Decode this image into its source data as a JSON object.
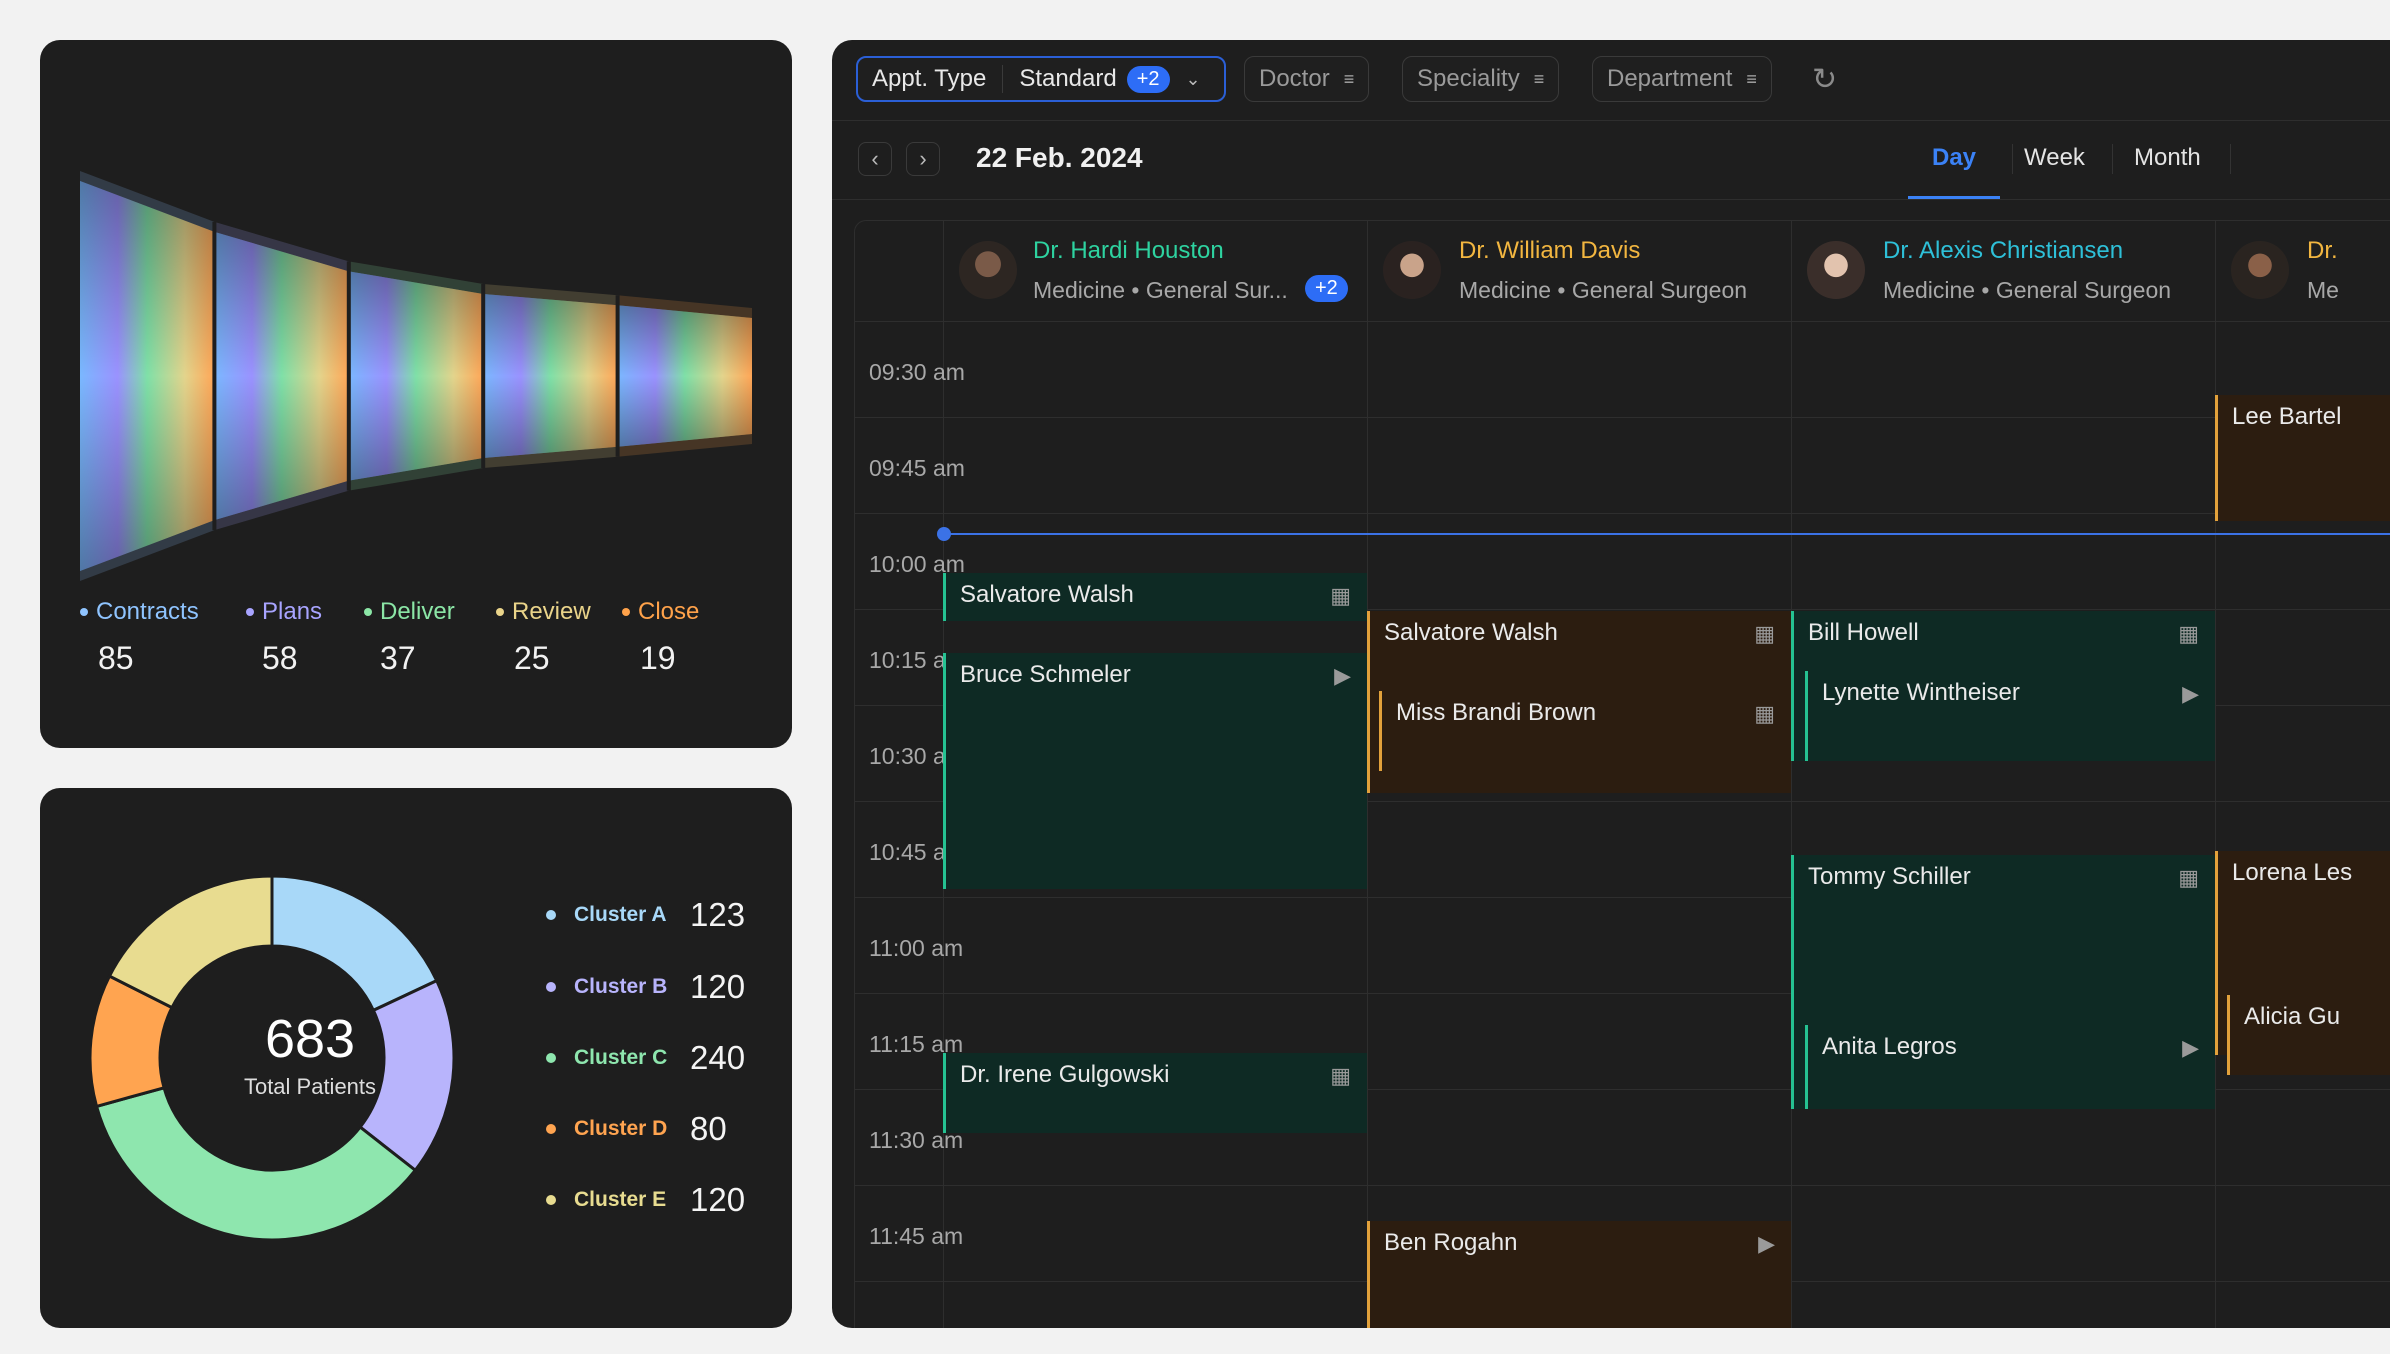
{
  "funnel": {
    "stages": [
      {
        "name": "Contracts",
        "value": "85",
        "color": "#8fc4ff"
      },
      {
        "name": "Plans",
        "value": "58",
        "color": "#a8a4ff"
      },
      {
        "name": "Deliver",
        "value": "37",
        "color": "#8be6a6"
      },
      {
        "name": "Review",
        "value": "25",
        "color": "#ead48a"
      },
      {
        "name": "Close",
        "value": "19",
        "color": "#ffa24a"
      }
    ]
  },
  "donut": {
    "total": "683",
    "caption": "Total Patients",
    "clusters": [
      {
        "name": "Cluster A",
        "value": "123",
        "color": "#a8d8f8"
      },
      {
        "name": "Cluster B",
        "value": "120",
        "color": "#b8b4fc"
      },
      {
        "name": "Cluster C",
        "value": "240",
        "color": "#8ee6ae"
      },
      {
        "name": "Cluster D",
        "value": "80",
        "color": "#ffa450"
      },
      {
        "name": "Cluster E",
        "value": "120",
        "color": "#e8dc90"
      }
    ]
  },
  "scheduler": {
    "filters": {
      "appt_type_label": "Appt. Type",
      "appt_type_value": "Standard",
      "appt_type_badge": "+2",
      "doctor": "Doctor",
      "speciality": "Speciality",
      "department": "Department"
    },
    "date": "22 Feb. 2024",
    "views": {
      "day": "Day",
      "week": "Week",
      "month": "Month"
    },
    "times": [
      "09:30 am",
      "09:45 am",
      "10:00 am",
      "10:15 am",
      "10:30 am",
      "10:45 am",
      "11:00 am",
      "11:15 am",
      "11:30 am",
      "11:45 am"
    ],
    "doctors": [
      {
        "name": "Dr. Hardi Houston",
        "sub": "Medicine • General Sur...",
        "badge": "+2",
        "color": "#2ed3a0"
      },
      {
        "name": "Dr. William Davis",
        "sub": "Medicine • General Surgeon",
        "color": "#f2b640"
      },
      {
        "name": "Dr. Alexis Christiansen",
        "sub": "Medicine • General Surgeon",
        "color": "#2ec0d8"
      },
      {
        "name": "Dr.",
        "sub": "Me",
        "color": "#f2b640"
      }
    ],
    "appointments": {
      "a1": "Salvatore Walsh",
      "a2": "Bruce Schmeler",
      "a3": "Dr. Irene Gulgowski",
      "a4": "Salvatore Walsh",
      "a5": "Miss Brandi Brown",
      "a6": "Ben Rogahn",
      "a7": "Bill Howell",
      "a8": "Lynette Wintheiser",
      "a9": "Tommy Schiller",
      "a10": "Anita Legros",
      "a11": "Lee Bartel",
      "a12": "Lorena Les",
      "a13": "Alicia Gu"
    }
  }
}
